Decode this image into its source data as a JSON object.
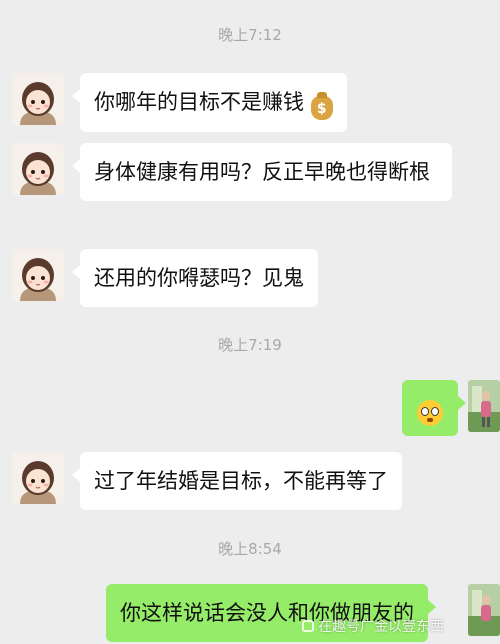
{
  "timestamps": [
    "晚上7:12",
    "晚上7:19",
    "晚上8:54"
  ],
  "messages": [
    {
      "text": "你哪年的目标不是赚钱",
      "emoji": "money-bag"
    },
    {
      "text": "身体健康有用吗？反正早晚也得断根"
    },
    {
      "text": "还用的你嘚瑟吗？见鬼"
    },
    {
      "emoji": "flushed-face"
    },
    {
      "text": "过了年结婚是目标，不能再等了"
    },
    {
      "text": "你这样说话会没人和你做朋友的"
    }
  ],
  "watermark": "在趣号广金以壹东西",
  "colors": {
    "background": "#ededed",
    "incoming_bubble": "#ffffff",
    "outgoing_bubble": "#95ec69"
  }
}
